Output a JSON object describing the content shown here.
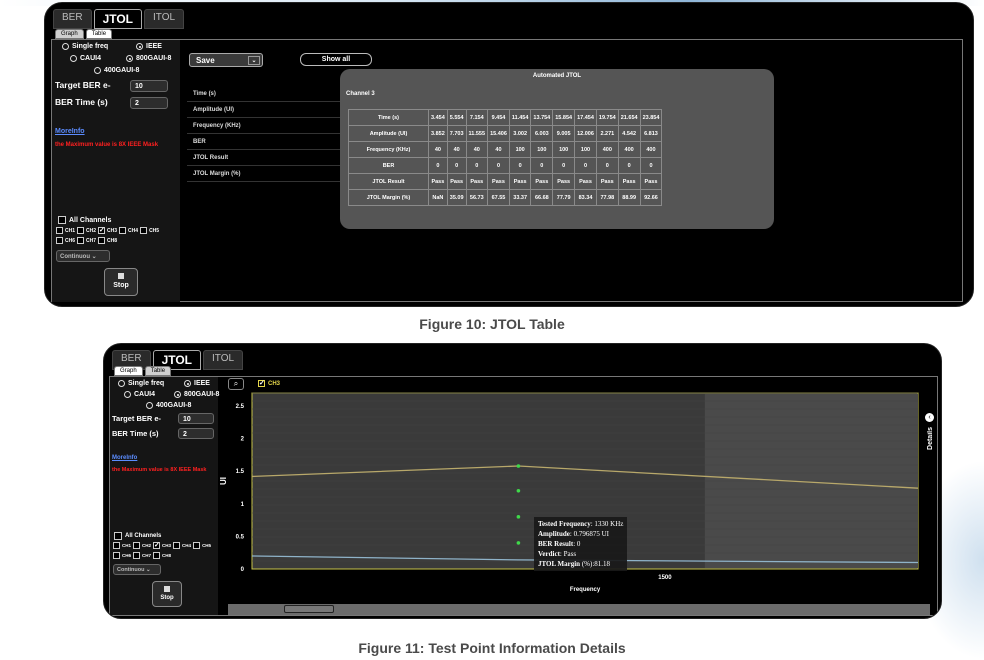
{
  "tabs": [
    "BER",
    "JTOL",
    "ITOL"
  ],
  "subtabs": [
    "Graph",
    "Table"
  ],
  "left_panel": {
    "radio_single": "Single freq",
    "radio_ieee": "IEEE",
    "radio_caui4": "CAUI4",
    "radio_800": "800GAUI-8",
    "radio_400": "400GAUI-8",
    "target_ber_label": "Target BER e-",
    "target_ber_value": "10",
    "ber_time_label": "BER Time (s)",
    "ber_time_value": "2",
    "moreinfo": "MoreInfo",
    "warning": "the Maximum value is 8X IEEE Mask",
    "all_channels": "All Channels",
    "channels": [
      "CH1",
      "CH2",
      "CH3",
      "CH4",
      "CH5",
      "CH6",
      "CH7",
      "CH8"
    ],
    "checked_channel": "CH3",
    "mode": "Continuou",
    "stop": "Stop"
  },
  "table_view": {
    "save": "Save",
    "show_all": "Show all",
    "row_labels": [
      "Time (s)",
      "Amplitude (UI)",
      "Frequency (KHz)",
      "BER",
      "JTOL Result",
      "JTOL Margin (%)"
    ],
    "title": "Automated JTOL",
    "channel": "Channel 3",
    "rows": [
      {
        "label": "Time (s)",
        "values": [
          "3.454",
          "5.554",
          "7.154",
          "9.454",
          "11.454",
          "13.754",
          "15.854",
          "17.454",
          "19.754",
          "21.654",
          "23.854"
        ]
      },
      {
        "label": "Amplitude (UI)",
        "values": [
          "3.852",
          "7.703",
          "11.555",
          "15.406",
          "3.002",
          "6.003",
          "9.005",
          "12.006",
          "2.271",
          "4.542",
          "6.813"
        ]
      },
      {
        "label": "Frequency (KHz)",
        "values": [
          "40",
          "40",
          "40",
          "40",
          "100",
          "100",
          "100",
          "100",
          "400",
          "400",
          "400"
        ]
      },
      {
        "label": "BER",
        "values": [
          "0",
          "0",
          "0",
          "0",
          "0",
          "0",
          "0",
          "0",
          "0",
          "0",
          "0"
        ]
      },
      {
        "label": "JTOL Result",
        "values": [
          "Pass",
          "Pass",
          "Pass",
          "Pass",
          "Pass",
          "Pass",
          "Pass",
          "Pass",
          "Pass",
          "Pass",
          "Pass"
        ]
      },
      {
        "label": "JTOL Margin (%)",
        "values": [
          "NaN",
          "35.09",
          "56.73",
          "67.55",
          "33.37",
          "66.68",
          "77.79",
          "83.34",
          "77.98",
          "88.99",
          "92.66"
        ]
      }
    ]
  },
  "captions": {
    "fig10": "Figure 10: JTOL Table",
    "fig11": "Figure 11: Test Point Information Details"
  },
  "graph_view": {
    "series_label": "CH3",
    "details_label": "Details",
    "zoom_icon": "magnifier-icon",
    "tooltip": {
      "freq_label": "Tested Frequency",
      "freq_value": ": 1330 KHz",
      "amp_label": "Amplitude",
      "amp_value": ": 0.796875 UI",
      "ber_label": "BER Result",
      "ber_value": ": 0",
      "verdict_label": "Verdict",
      "verdict_value": ": Pass",
      "margin_label": "JTOL Margin",
      "margin_value": " (%):81.18"
    }
  },
  "chart_data": {
    "type": "line",
    "xlabel": "Frequency",
    "ylabel": "UI",
    "y_ticks": [
      "2.5",
      "2",
      "1.5",
      "1",
      "0.5",
      "0"
    ],
    "x_ticks": [
      "1500"
    ],
    "ylim": [
      0,
      2.7
    ],
    "series": [
      {
        "name": "CH3",
        "color": "#b8a86a",
        "points": [
          [
            0,
            1.42
          ],
          [
            0.4,
            1.58
          ],
          [
            1,
            1.24
          ]
        ]
      },
      {
        "color": "#8fb3c9",
        "points": [
          [
            0,
            0.2
          ],
          [
            0.4,
            0.14
          ],
          [
            1,
            0.1
          ]
        ]
      }
    ],
    "test_points": [
      {
        "x": 0.4,
        "y": 1.58
      },
      {
        "x": 0.4,
        "y": 1.2
      },
      {
        "x": 0.4,
        "y": 0.8
      },
      {
        "x": 0.4,
        "y": 0.4
      }
    ]
  }
}
